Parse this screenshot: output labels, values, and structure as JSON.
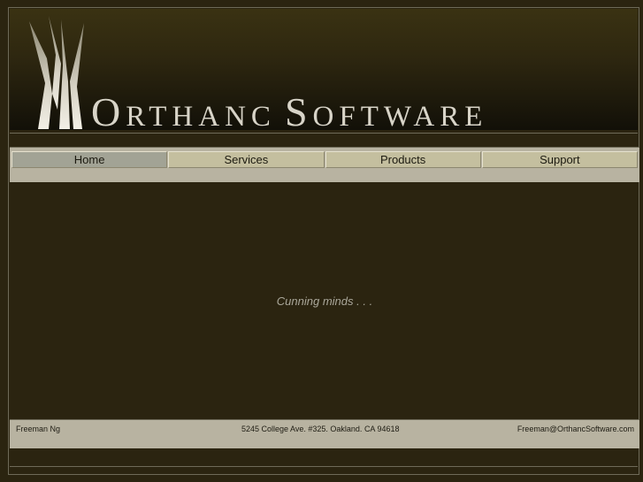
{
  "header": {
    "brand_word1_initial": "O",
    "brand_word1_rest": "RTHANC",
    "brand_word2_initial": "S",
    "brand_word2_rest": "OFTWARE",
    "logo_icon": "stylized-tower-icon"
  },
  "nav": {
    "items": [
      {
        "label": "Home",
        "active": true
      },
      {
        "label": "Services",
        "active": false
      },
      {
        "label": "Products",
        "active": false
      },
      {
        "label": "Support",
        "active": false
      }
    ]
  },
  "main": {
    "tagline": "Cunning minds . . ."
  },
  "footer": {
    "name": "Freeman Ng",
    "address": "5245 College Ave. #325. Oakland. CA 94618",
    "email": "Freeman@OrthancSoftware.com"
  },
  "colors": {
    "background": "#2b2410",
    "bar": "#b8b3a1",
    "tab": "#c4bf9f",
    "tab_active": "#a2a395",
    "text_light": "#d8d4c8"
  }
}
